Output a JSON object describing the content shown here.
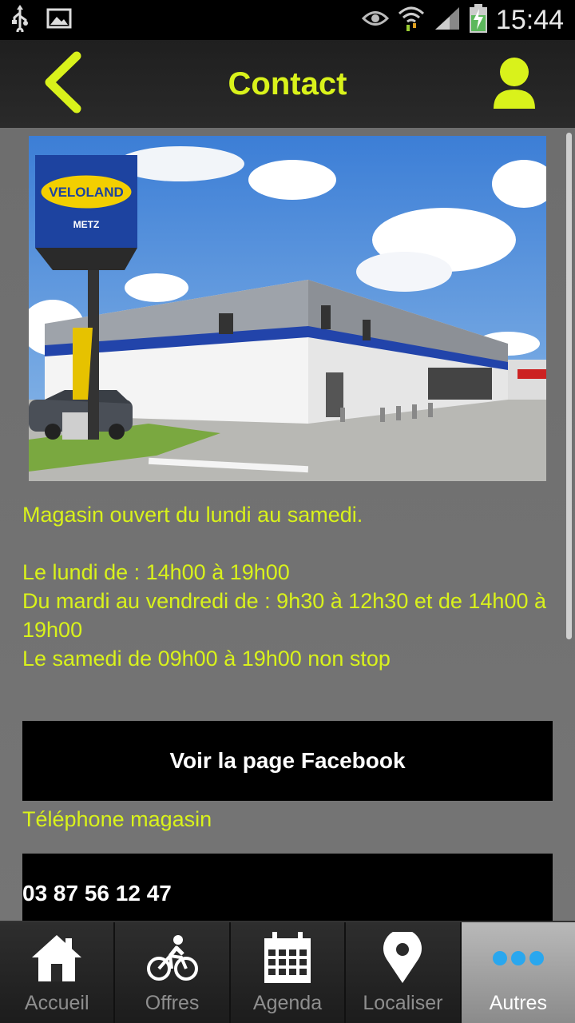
{
  "status_bar": {
    "time": "15:44",
    "icons": [
      "usb-icon",
      "image-icon",
      "eye-icon",
      "wifi-icon",
      "signal-icon",
      "battery-charging-icon"
    ]
  },
  "header": {
    "title": "Contact",
    "back_icon": "chevron-left-icon",
    "profile_icon": "user-icon",
    "accent_color": "#d9f21b"
  },
  "content": {
    "photo_sign_text": "VELOLAND",
    "photo_sign_subtext": "METZ",
    "hours": {
      "intro": "Magasin ouvert du lundi au samedi.",
      "monday": "Le lundi de : 14h00 à 19h00",
      "tue_fri": "Du mardi au vendredi de : 9h30 à 12h30 et de 14h00 à 19h00",
      "saturday": "Le samedi de 09h00 à 19h00 non stop"
    },
    "facebook_button": "Voir la page Facebook",
    "phone_label": "Téléphone magasin",
    "phone_number": "03 87 56 12 47"
  },
  "tabs": [
    {
      "label": "Accueil",
      "icon": "home-icon",
      "active": false
    },
    {
      "label": "Offres",
      "icon": "cyclist-icon",
      "active": false
    },
    {
      "label": "Agenda",
      "icon": "calendar-icon",
      "active": false
    },
    {
      "label": "Localiser",
      "icon": "map-pin-icon",
      "active": false
    },
    {
      "label": "Autres",
      "icon": "more-dots-icon",
      "active": true
    }
  ]
}
